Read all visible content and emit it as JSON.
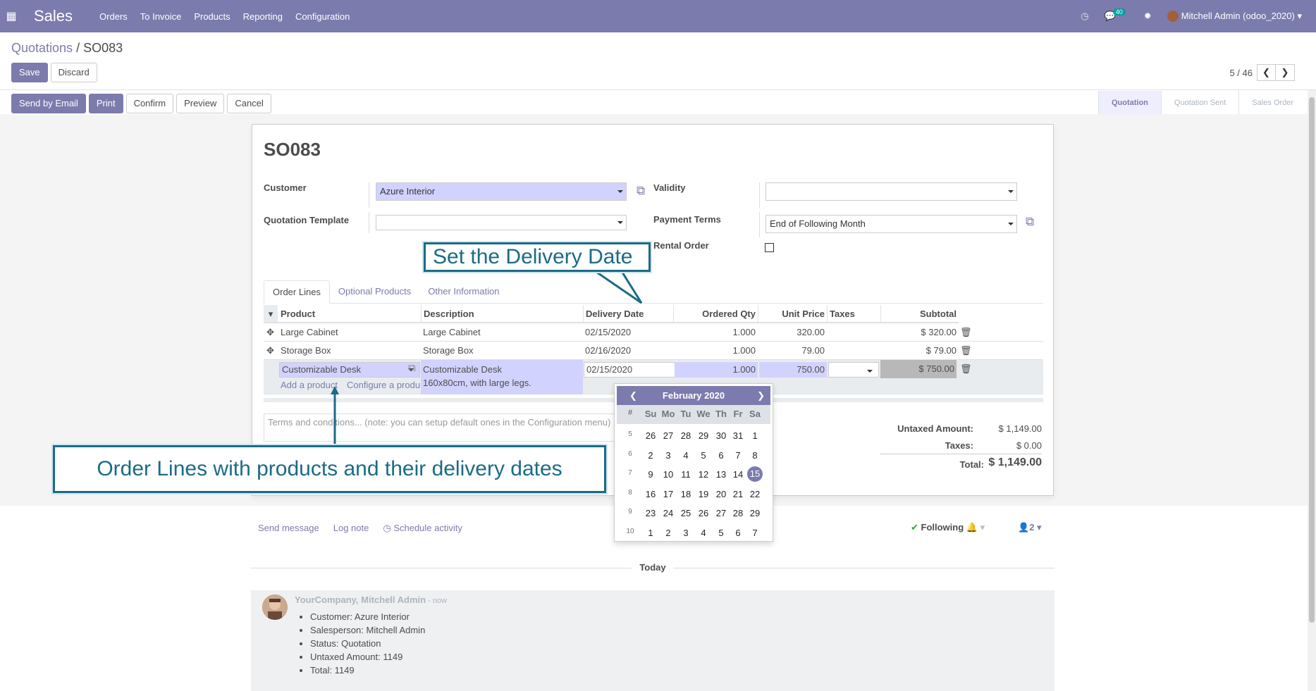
{
  "navbar": {
    "brand": "Sales",
    "menu": [
      "Orders",
      "To Invoice",
      "Products",
      "Reporting",
      "Configuration"
    ],
    "messages_count": "40",
    "user": "Mitchell Admin (odoo_2020)"
  },
  "breadcrumb": {
    "parent": "Quotations",
    "separator": " / ",
    "current": "SO083"
  },
  "actions": {
    "save": "Save",
    "discard": "Discard"
  },
  "pager": {
    "value": "5 / 46"
  },
  "status_buttons": [
    "Send by Email",
    "Print",
    "Confirm",
    "Preview",
    "Cancel"
  ],
  "status_steps": [
    "Quotation",
    "Quotation Sent",
    "Sales Order"
  ],
  "form": {
    "title": "SO083",
    "customer_label": "Customer",
    "customer_value": "Azure Interior",
    "template_label": "Quotation Template",
    "template_value": "",
    "validity_label": "Validity",
    "validity_value": "",
    "payment_terms_label": "Payment Terms",
    "payment_terms_value": "End of Following Month",
    "rental_label": "Rental Order"
  },
  "tabs": [
    "Order Lines",
    "Optional Products",
    "Other Information"
  ],
  "table": {
    "headers": [
      "Product",
      "Description",
      "Delivery Date",
      "Ordered Qty",
      "Unit Price",
      "Taxes",
      "Subtotal"
    ],
    "rows": [
      {
        "product": "Large Cabinet",
        "description": "Large Cabinet",
        "date": "02/15/2020",
        "qty": "1.000",
        "price": "320.00",
        "taxes": "",
        "subtotal": "$ 320.00"
      },
      {
        "product": "Storage Box",
        "description": "Storage Box",
        "date": "02/16/2020",
        "qty": "1.000",
        "price": "79.00",
        "taxes": "",
        "subtotal": "$ 79.00"
      }
    ],
    "edit_row": {
      "product": "Customizable Desk",
      "description_1": "Customizable Desk",
      "description_2": "160x80cm, with large legs.",
      "date": "02/15/2020",
      "qty": "1.000",
      "price": "750.00",
      "subtotal": "$ 750.00"
    },
    "add_product": "Add a product",
    "configure_product": "Configure a produ"
  },
  "terms_placeholder": "Terms and conditions... (note: you can setup default ones in the Configuration menu)",
  "totals": {
    "untaxed_label": "Untaxed Amount:",
    "untaxed_value": "$ 1,149.00",
    "taxes_label": "Taxes:",
    "taxes_value": "$ 0.00",
    "total_label": "Total:",
    "total_value": "$ 1,149.00"
  },
  "datepicker": {
    "month": "February 2020",
    "dow": [
      "#",
      "Su",
      "Mo",
      "Tu",
      "We",
      "Th",
      "Fr",
      "Sa"
    ],
    "weeks": [
      [
        "5",
        "26",
        "27",
        "28",
        "29",
        "30",
        "31",
        "1"
      ],
      [
        "6",
        "2",
        "3",
        "4",
        "5",
        "6",
        "7",
        "8"
      ],
      [
        "7",
        "9",
        "10",
        "11",
        "12",
        "13",
        "14",
        "15"
      ],
      [
        "8",
        "16",
        "17",
        "18",
        "19",
        "20",
        "21",
        "22"
      ],
      [
        "9",
        "23",
        "24",
        "25",
        "26",
        "27",
        "28",
        "29"
      ],
      [
        "10",
        "1",
        "2",
        "3",
        "4",
        "5",
        "6",
        "7"
      ]
    ],
    "selected": "15"
  },
  "chatter": {
    "send_message": "Send message",
    "log_note": "Log note",
    "schedule_activity": "Schedule activity",
    "following": "Following",
    "followers_count": "2",
    "today": "Today",
    "author": "YourCompany, Mitchell Admin",
    "time": " - now",
    "items": [
      "Customer: Azure Interior",
      "Salesperson: Mitchell Admin",
      "Status: Quotation",
      "Untaxed Amount: 1149",
      "Total: 1149"
    ]
  },
  "callouts": {
    "delivery": "Set the Delivery Date",
    "order_lines": "Order Lines with products and their delivery dates"
  },
  "colors": {
    "brand": "#7c7bad",
    "callout": "#1b6b86",
    "required_field": "#d2d2ff"
  }
}
